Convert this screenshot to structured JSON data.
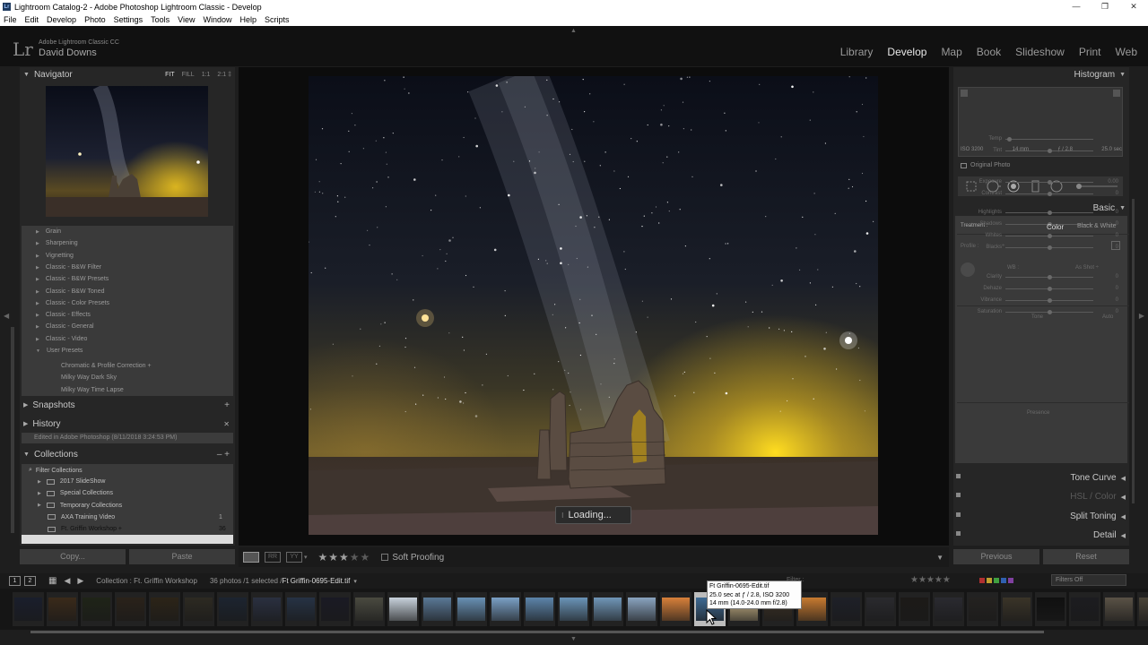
{
  "window": {
    "title": "Lightroom Catalog-2 - Adobe Photoshop Lightroom Classic - Develop",
    "controls": [
      "—",
      "❐",
      "✕"
    ]
  },
  "menu": [
    "File",
    "Edit",
    "Develop",
    "Photo",
    "Settings",
    "Tools",
    "View",
    "Window",
    "Help",
    "Scripts"
  ],
  "identity": {
    "logo": "Lr",
    "app_name": "Adobe Lightroom Classic CC",
    "user": "David Downs"
  },
  "modules": [
    {
      "label": "Library",
      "active": false
    },
    {
      "label": "Develop",
      "active": true
    },
    {
      "label": "Map",
      "active": false
    },
    {
      "label": "Book",
      "active": false
    },
    {
      "label": "Slideshow",
      "active": false
    },
    {
      "label": "Print",
      "active": false
    },
    {
      "label": "Web",
      "active": false
    }
  ],
  "left": {
    "navigator": {
      "title": "Navigator",
      "options": [
        "FIT",
        "FILL",
        "1:1",
        "2:1 ‡"
      ]
    },
    "presets": [
      "Grain",
      "Sharpening",
      "Vignetting",
      "Classic - B&W Filter",
      "Classic - B&W Presets",
      "Classic - B&W Toned",
      "Classic - Color Presets",
      "Classic - Effects",
      "Classic - General",
      "Classic - Video",
      "User Presets"
    ],
    "user_presets": [
      "Chromatic & Profile Correction  +",
      "Milky Way Dark Sky",
      "Milky Way Time Lapse"
    ],
    "snapshots": {
      "title": "Snapshots",
      "action": "+"
    },
    "history": {
      "title": "History",
      "action": "✕",
      "item": "Edited in Adobe Photoshop (8/11/2018 3:24:53 PM)"
    },
    "collections": {
      "title": "Collections",
      "actions": "–  +",
      "filter": "Filter Collections",
      "items": [
        {
          "label": "2017 SlideShow",
          "count": ""
        },
        {
          "label": "Special Collections",
          "count": ""
        },
        {
          "label": "Temporary Collections",
          "count": ""
        },
        {
          "label": "AXA Training Video",
          "count": "1"
        },
        {
          "label": "Ft. Griffin Workshop  +",
          "count": "36"
        }
      ]
    },
    "copy": "Copy...",
    "paste": "Paste"
  },
  "canvas": {
    "loading": "Loading..."
  },
  "toolbar": {
    "stars": "★★★",
    "stars_empty": "★★",
    "soft_proofing": "Soft Proofing"
  },
  "right": {
    "histogram": {
      "title": "Histogram",
      "iso": "ISO 3200",
      "focal": "14 mm",
      "aperture": "ƒ / 2.8",
      "shutter": "25.0 sec",
      "original_photo": "Original Photo"
    },
    "basic": {
      "title": "Basic",
      "treatment_label": "Treatment :",
      "color": "Color",
      "bw": "Black & White",
      "profile": "Profile :",
      "wb_label": "WB :",
      "wb_value": "As Shot ÷",
      "tone_label": "Tone",
      "auto": "Auto",
      "presence_label": "Presence",
      "sliders": [
        {
          "label": "Temp",
          "value": "",
          "pos": 0.05
        },
        {
          "label": "Tint",
          "value": "",
          "pos": 0.5
        },
        {
          "label": "Exposure",
          "value": "0.00",
          "pos": 0.5
        },
        {
          "label": "Contrast",
          "value": "0",
          "pos": 0.5
        },
        {
          "label": "Highlights",
          "value": "0",
          "pos": 0.5
        },
        {
          "label": "Shadows",
          "value": "0",
          "pos": 0.5
        },
        {
          "label": "Whites",
          "value": "0",
          "pos": 0.5
        },
        {
          "label": "Blacks",
          "value": "0",
          "pos": 0.5
        },
        {
          "label": "Clarity",
          "value": "0",
          "pos": 0.5
        },
        {
          "label": "Dehaze",
          "value": "0",
          "pos": 0.5
        },
        {
          "label": "Vibrance",
          "value": "0",
          "pos": 0.5
        },
        {
          "label": "Saturation",
          "value": "0",
          "pos": 0.5
        }
      ]
    },
    "panels": [
      {
        "label": "Tone Curve",
        "dim": false
      },
      {
        "label": "HSL / Color",
        "dim": true
      },
      {
        "label": "Split Toning",
        "dim": false
      },
      {
        "label": "Detail",
        "dim": false
      }
    ],
    "previous": "Previous",
    "reset": "Reset"
  },
  "filmstrip": {
    "screens": [
      "1",
      "2"
    ],
    "source": "Collection : Ft. Griffin Workshop",
    "count": "36 photos /1 selected /",
    "file": "Ft Griffin-0695-Edit.tif",
    "filter_label": "Filter :",
    "filter_stars": "★★★★★",
    "filters_off": "Filters Off",
    "thumb_colors": [
      "#1a1e2c",
      "#3a2a1a",
      "#1f2418",
      "#2a221a",
      "#2c2418",
      "#2d2a22",
      "#1c2430",
      "#2a3040",
      "#263244",
      "#1a1a24",
      "#4a4a40",
      "#c8d2dc",
      "#5a7896",
      "#6890b4",
      "#7aa0c6",
      "#5c84aa",
      "#6a94b8",
      "#7096b8",
      "#8aa4c0",
      "#d8803a",
      "#3e6a94",
      "#cdb88a",
      "#3a3024",
      "#c87a30",
      "#1e2028",
      "#2a2a2e",
      "#1c1a18",
      "#2a2a30",
      "#242220",
      "#3a3428",
      "#101010",
      "#1c1c20",
      "#5a5246",
      "#4a4438"
    ],
    "tooltip": [
      "Ft Griffin-0695-Edit.tif",
      "25.0 sec at ƒ / 2.8, ISO 3200",
      "14 mm (14.0-24.0 mm f/2.8)"
    ]
  }
}
